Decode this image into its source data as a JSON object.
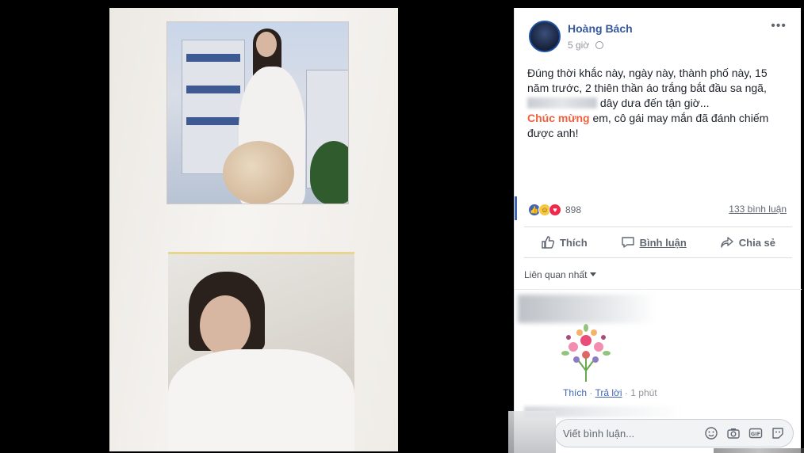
{
  "post": {
    "author": "Hoàng Bách",
    "time": "5 giờ",
    "line1": "Đúng thời khắc này, ngày này, thành phố này, 15 năm trước, 2 thiên thần áo trắng bắt đầu sa ngã,",
    "line2_after_blur": " dây dưa đến tận giờ...",
    "highlight": "Chúc mừng",
    "line3": " em, cô gái may mắn đã đánh chiếm được anh!",
    "more_icon": "ellipsis-icon",
    "privacy_icon": "globe-icon"
  },
  "stats": {
    "reaction_count": "898",
    "comments_label": "133 bình luận"
  },
  "actions": {
    "like": "Thích",
    "comment": "Bình luận",
    "share": "Chia sẻ"
  },
  "comments": {
    "sort_label": "Liên quan nhất",
    "comment_like": "Thích",
    "comment_reply": "Trả lời",
    "separator": "·",
    "comment_time": "1 phút"
  },
  "composer": {
    "placeholder": "Viết bình luận..."
  },
  "colors": {
    "link_blue": "#365899",
    "highlight_orange": "#f0613c",
    "facebook_blue": "#4267b2"
  }
}
